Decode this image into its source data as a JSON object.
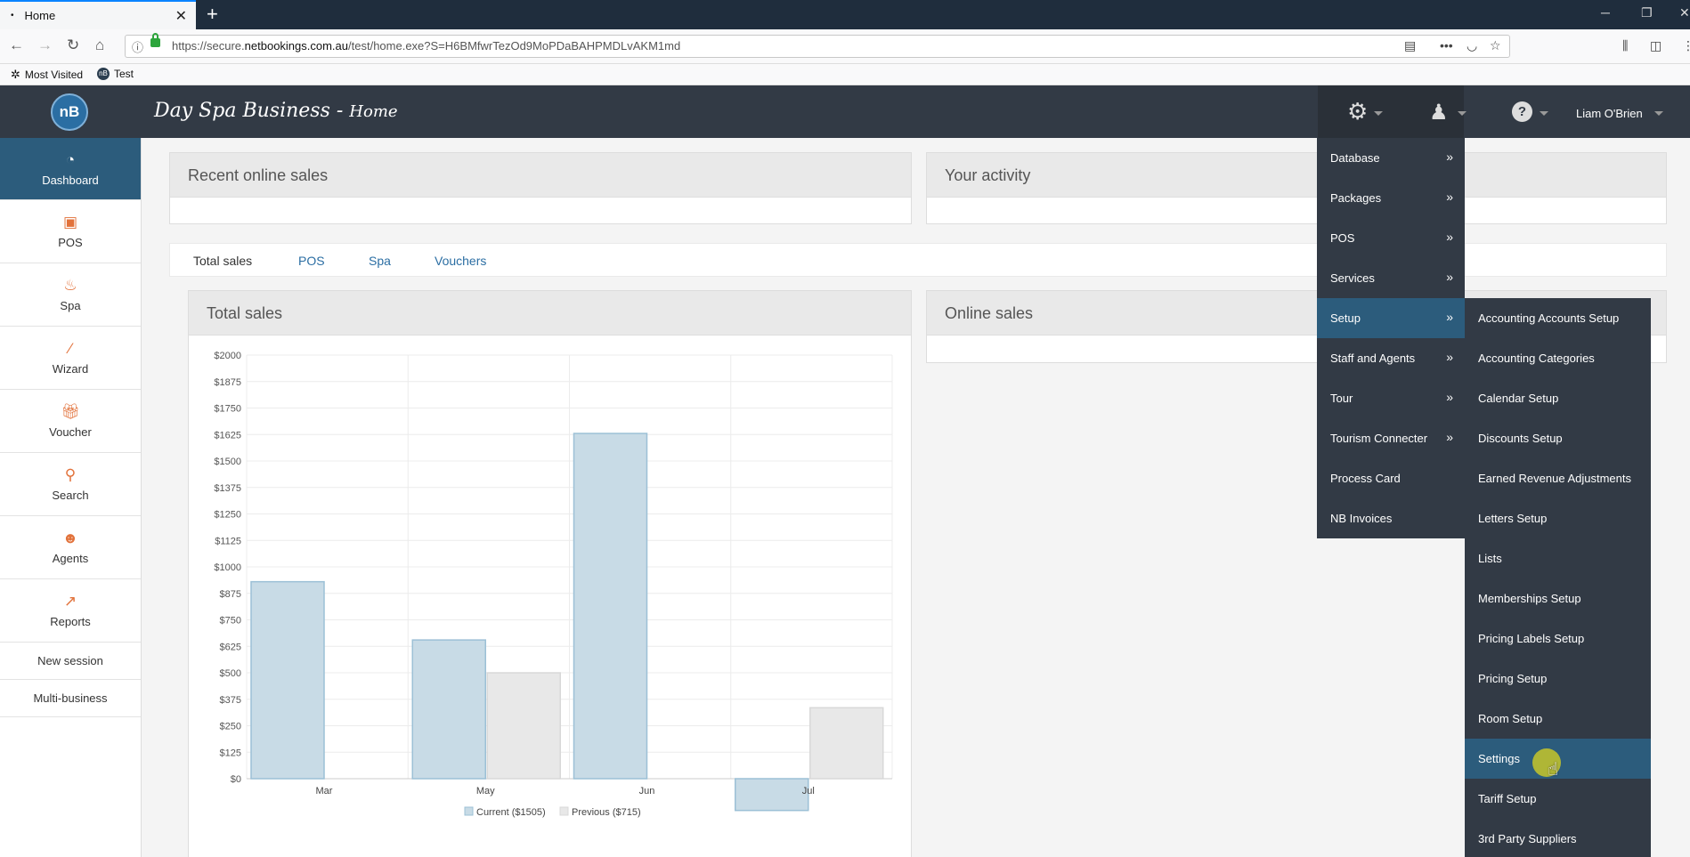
{
  "browser": {
    "tab_title": "Home",
    "url_prefix": "https://secure.",
    "url_host": "netbookings.com.au",
    "url_rest": "/test/home.exe?S=H6BMfwrTezOd9MoPDaBAHPMDLvAKM1md",
    "bookmarks": [
      {
        "icon": "gear-icon",
        "label": "Most Visited"
      },
      {
        "icon": "nb-icon",
        "label": "Test"
      }
    ]
  },
  "app": {
    "logo_text": "nB",
    "title": "Day Spa Business - ",
    "subtitle": "Home",
    "user": "Liam O'Brien"
  },
  "sidebar": {
    "items": [
      {
        "label": "Dashboard",
        "icon": "dashboard-icon"
      },
      {
        "label": "POS",
        "icon": "pos-icon"
      },
      {
        "label": "Spa",
        "icon": "spa-icon"
      },
      {
        "label": "Wizard",
        "icon": "wizard-icon"
      },
      {
        "label": "Voucher",
        "icon": "gift-icon"
      },
      {
        "label": "Search",
        "icon": "search-icon"
      },
      {
        "label": "Agents",
        "icon": "agents-icon"
      },
      {
        "label": "Reports",
        "icon": "reports-icon"
      }
    ],
    "links": [
      "New session",
      "Multi-business"
    ]
  },
  "panels": {
    "recent_online_sales": "Recent online sales",
    "your_activity": "Your activity",
    "online_sales": "Online sales"
  },
  "tabs": [
    "Total sales",
    "POS",
    "Spa",
    "Vouchers"
  ],
  "chart_data": {
    "type": "bar",
    "title": "Total sales",
    "categories": [
      "Mar",
      "May",
      "Jun",
      "Jul"
    ],
    "series": [
      {
        "name": "Current ($1505)",
        "values": [
          930,
          655,
          1630,
          -150
        ],
        "color": "#c8dbe6"
      },
      {
        "name": "Previous ($715)",
        "values": [
          0,
          500,
          0,
          335
        ],
        "color": "#e8e8e8"
      }
    ],
    "y_ticks": [
      "$2000",
      "$1875",
      "$1750",
      "$1625",
      "$1500",
      "$1375",
      "$1250",
      "$1125",
      "$1000",
      "$875",
      "$750",
      "$625",
      "$500",
      "$375",
      "$250",
      "$125",
      "$0"
    ],
    "ylim": [
      0,
      2000
    ]
  },
  "menu": {
    "main": [
      {
        "label": "Database",
        "arrow": "»"
      },
      {
        "label": "Packages",
        "arrow": "»"
      },
      {
        "label": "POS",
        "arrow": "»"
      },
      {
        "label": "Services",
        "arrow": "»"
      },
      {
        "label": "Setup",
        "arrow": "»"
      },
      {
        "label": "Staff and Agents",
        "arrow": "»"
      },
      {
        "label": "Tour",
        "arrow": "»"
      },
      {
        "label": "Tourism Connecter",
        "arrow": "»"
      },
      {
        "label": "Process Card",
        "arrow": ""
      },
      {
        "label": "NB Invoices",
        "arrow": ""
      }
    ],
    "setup": [
      "Accounting Accounts Setup",
      "Accounting Categories",
      "Calendar Setup",
      "Discounts Setup",
      "Earned Revenue Adjustments",
      "Letters Setup",
      "Lists",
      "Memberships Setup",
      "Pricing Labels Setup",
      "Pricing Setup",
      "Room Setup",
      "Settings",
      "Tariff Setup",
      "3rd Party Suppliers"
    ]
  }
}
